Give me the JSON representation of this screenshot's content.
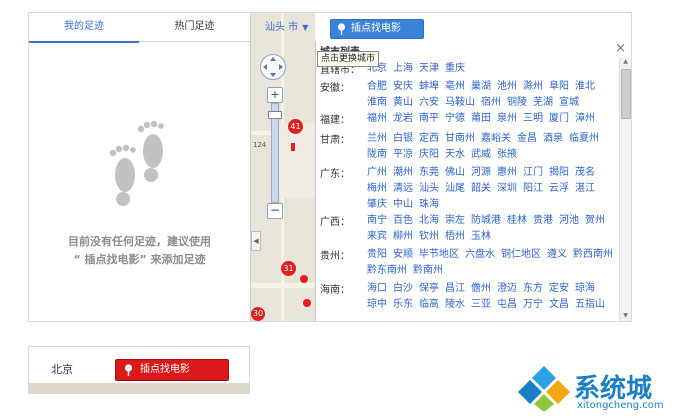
{
  "tabs": {
    "my_footprints": "我的足迹",
    "hot_footprints": "热门足迹"
  },
  "empty_message": {
    "line1": "目前没有任何足迹，建议使用",
    "line2": "“ 插点找电影” 来添加足迹"
  },
  "city_selector": {
    "current_city": "汕头 市",
    "find_movie_button": "插点找电影",
    "tooltip": "点击更换城市"
  },
  "popup": {
    "title": "城市列表",
    "provinces": [
      {
        "name": "直辖市：",
        "cities": [
          "北京",
          "上海",
          "天津",
          "重庆"
        ]
      },
      {
        "name": "安徽：",
        "cities": [
          "合肥",
          "安庆",
          "蚌埠",
          "亳州",
          "巢湖",
          "池州",
          "滁州",
          "阜阳",
          "淮北",
          "淮南",
          "黄山",
          "六安",
          "马鞍山",
          "宿州",
          "铜陵",
          "芜湖",
          "宣城"
        ]
      },
      {
        "name": "福建：",
        "cities": [
          "福州",
          "龙岩",
          "南平",
          "宁德",
          "莆田",
          "泉州",
          "三明",
          "厦门",
          "漳州"
        ]
      },
      {
        "name": "甘肃：",
        "cities": [
          "兰州",
          "白银",
          "定西",
          "甘南州",
          "嘉峪关",
          "金昌",
          "酒泉",
          "临夏州",
          "陇南",
          "平凉",
          "庆阳",
          "天水",
          "武威",
          "张掖"
        ]
      },
      {
        "name": "广东：",
        "cities": [
          "广州",
          "潮州",
          "东莞",
          "佛山",
          "河源",
          "惠州",
          "江门",
          "揭阳",
          "茂名",
          "梅州",
          "清远",
          "汕头",
          "汕尾",
          "韶关",
          "深圳",
          "阳江",
          "云浮",
          "湛江",
          "肇庆",
          "中山",
          "珠海"
        ]
      },
      {
        "name": "广西：",
        "cities": [
          "南宁",
          "百色",
          "北海",
          "崇左",
          "防城港",
          "桂林",
          "贵港",
          "河池",
          "贺州",
          "来宾",
          "柳州",
          "钦州",
          "梧州",
          "玉林"
        ]
      },
      {
        "name": "贵州：",
        "cities": [
          "贵阳",
          "安顺",
          "毕节地区",
          "六盘水",
          "铜仁地区",
          "遵义",
          "黔西南州",
          "黔东南州",
          "黔南州"
        ]
      },
      {
        "name": "海南：",
        "cities": [
          "海口",
          "白沙",
          "保亭",
          "昌江",
          "儋州",
          "澄迈",
          "东方",
          "定安",
          "琼海",
          "琼中",
          "乐东",
          "临高",
          "陵水",
          "三亚",
          "屯昌",
          "万宁",
          "文昌",
          "五指山"
        ]
      }
    ]
  },
  "map": {
    "markers": [
      "41",
      "31",
      "30"
    ],
    "scale_label": "124"
  },
  "second_view": {
    "current_city": "北京",
    "find_movie_button": "插点找电影"
  },
  "watermark": {
    "brand": "系统城",
    "url": "xitongcheng.com"
  },
  "colors": {
    "accent_blue": "#3b83d8",
    "link_blue": "#2e63c9",
    "red_button": "#d9191c",
    "marker_red": "#e02020"
  }
}
